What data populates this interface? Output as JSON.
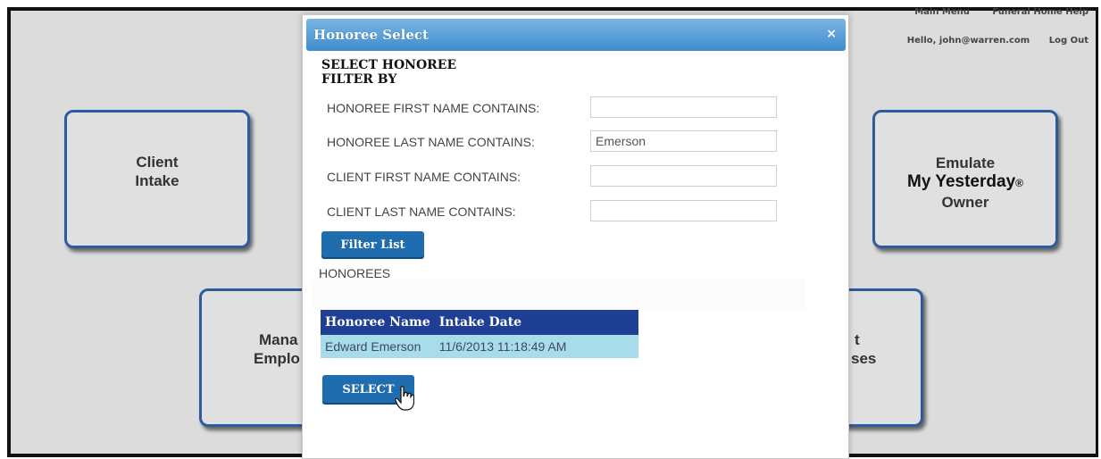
{
  "nav": {
    "main_menu": "Main Menu",
    "help": "Funeral Home Help",
    "greeting": "Hello, john@warren.com",
    "logout": "Log Out"
  },
  "tiles": {
    "client_intake": {
      "line1": "Client",
      "line2": "Intake"
    },
    "emulate": {
      "line1": "Emulate",
      "line2": "My Yesterday",
      "mark": "®",
      "line3": "Owner"
    },
    "manage": {
      "line1": "Mana",
      "line2": "Emplo"
    },
    "right_lower": {
      "line1": "t",
      "line2": "ses"
    }
  },
  "modal": {
    "title": "Honoree Select",
    "close": "×",
    "heading": "SELECT HONOREE",
    "subheading": "FILTER BY",
    "filters": [
      {
        "label": "HONOREE FIRST NAME CONTAINS:",
        "value": ""
      },
      {
        "label": "HONOREE LAST NAME CONTAINS:",
        "value": "Emerson"
      },
      {
        "label": "CLIENT FIRST NAME CONTAINS:",
        "value": ""
      },
      {
        "label": "CLIENT LAST NAME CONTAINS:",
        "value": ""
      }
    ],
    "filter_button": "Filter List",
    "honorees_label": "HONOREES",
    "table": {
      "columns": [
        "Honoree Name",
        "Intake Date"
      ],
      "rows": [
        [
          "Edward Emerson",
          "11/6/2013 11:18:49 AM"
        ]
      ]
    },
    "select_button": "SELECT"
  },
  "colors": {
    "accent": "#3f8ccd",
    "table_header": "#1e3f94",
    "row_highlight": "#a9dcea",
    "tile_border": "#2d5c9e"
  }
}
